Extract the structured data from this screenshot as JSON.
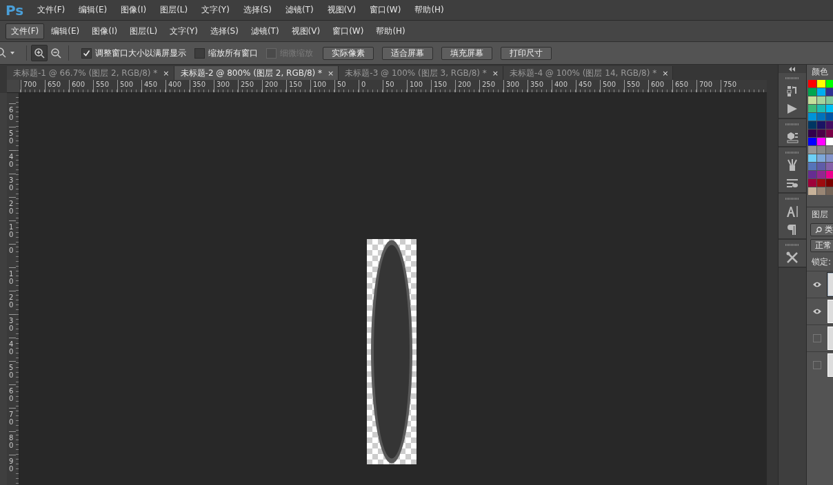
{
  "app_logo": "Ps",
  "menu_bar": [
    "文件(F)",
    "编辑(E)",
    "图像(I)",
    "图层(L)",
    "文字(Y)",
    "选择(S)",
    "滤镜(T)",
    "视图(V)",
    "窗口(W)",
    "帮助(H)"
  ],
  "second_menu_bar": [
    {
      "label": "文件(F)",
      "selected": true
    },
    {
      "label": "编辑(E)",
      "selected": false
    },
    {
      "label": "图像(I)",
      "selected": false
    },
    {
      "label": "图层(L)",
      "selected": false
    },
    {
      "label": "文字(Y)",
      "selected": false
    },
    {
      "label": "选择(S)",
      "selected": false
    },
    {
      "label": "滤镜(T)",
      "selected": false
    },
    {
      "label": "视图(V)",
      "selected": false
    },
    {
      "label": "窗口(W)",
      "selected": false
    },
    {
      "label": "帮助(H)",
      "selected": false
    }
  ],
  "options_bar": {
    "zoom_buttons": [
      {
        "kind": "zoom-in",
        "selected": true
      },
      {
        "kind": "zoom-out",
        "selected": false
      }
    ],
    "checkboxes": [
      {
        "label": "调整窗口大小以满屏显示",
        "checked": true,
        "disabled": false
      },
      {
        "label": "缩放所有窗口",
        "checked": false,
        "disabled": false
      },
      {
        "label": "细微缩放",
        "checked": false,
        "disabled": true
      }
    ],
    "buttons": [
      "实际像素",
      "适合屏幕",
      "填充屏幕",
      "打印尺寸"
    ]
  },
  "document_tabs": [
    {
      "title": "未标题-1 @ 66.7% (图层 2, RGB/8) *",
      "close": "×",
      "selected": false
    },
    {
      "title": "未标题-2 @ 800% (图层 2, RGB/8) *",
      "close": "×",
      "selected": true
    },
    {
      "title": "未标题-3 @ 100% (图层 3, RGB/8) *",
      "close": "×",
      "selected": false
    },
    {
      "title": "未标题-4 @ 100% (图层 14, RGB/8) *",
      "close": "×",
      "selected": false
    }
  ],
  "horizontal_ruler": [
    "700",
    "650",
    "600",
    "550",
    "500",
    "450",
    "400",
    "350",
    "300",
    "250",
    "200",
    "150",
    "100",
    "50",
    "0",
    "50",
    "100",
    "150",
    "200",
    "250",
    "300",
    "350",
    "400",
    "450",
    "500",
    "550",
    "600",
    "650",
    "700",
    "750"
  ],
  "vertical_ruler": [
    "60",
    "50",
    "40",
    "30",
    "20",
    "10",
    "0",
    "10",
    "20",
    "30",
    "40",
    "50",
    "60",
    "70",
    "80",
    "90"
  ],
  "color_panel": {
    "tab": "颜色",
    "swatches": [
      {
        "color": "#ff0000"
      },
      {
        "color": "#ffff00"
      },
      {
        "color": "#00ff00"
      },
      {
        "color": "#00a650"
      },
      {
        "color": "#00aeef"
      },
      {
        "color": "#2e3192"
      },
      {
        "color": "#c4df9b"
      },
      {
        "color": "#a3d39c"
      },
      {
        "color": "#82ca9c"
      },
      {
        "color": "#3cb878"
      },
      {
        "color": "#1cbbb4"
      },
      {
        "color": "#00bff3"
      },
      {
        "color": "#0094d9"
      },
      {
        "color": "#0072bc"
      },
      {
        "color": "#0054a6"
      },
      {
        "color": "#003663"
      },
      {
        "color": "#1b1464"
      },
      {
        "color": "#440e62"
      },
      {
        "color": "#32004b"
      },
      {
        "color": "#4b0049"
      },
      {
        "color": "#7b0046"
      },
      {
        "color": "#0000ff"
      },
      {
        "color": "#ff00ff"
      },
      {
        "color": "#ffffff"
      },
      {
        "color": "#959595"
      },
      {
        "color": "#898989"
      },
      {
        "color": "#7d7d7d"
      },
      {
        "color": "#6dcff6"
      },
      {
        "color": "#7da7d9"
      },
      {
        "color": "#8393ca"
      },
      {
        "color": "#5674b9"
      },
      {
        "color": "#605ca8"
      },
      {
        "color": "#8560a8"
      },
      {
        "color": "#662d91"
      },
      {
        "color": "#92278f"
      },
      {
        "color": "#ec008c"
      },
      {
        "color": "#9e0039"
      },
      {
        "color": "#9e0b0f"
      },
      {
        "color": "#790000"
      },
      {
        "color": "#c7b299"
      },
      {
        "color": "#998675"
      },
      {
        "color": "#736357"
      }
    ]
  },
  "layers_panel": {
    "tab": "图层",
    "filter": "类",
    "blend_mode": "正常",
    "lock_label": "锁定:",
    "layers": [
      {
        "visible": true,
        "selected": true
      },
      {
        "visible": true,
        "selected": false
      },
      {
        "visible": false,
        "selected": false
      },
      {
        "visible": false,
        "selected": false
      }
    ]
  }
}
